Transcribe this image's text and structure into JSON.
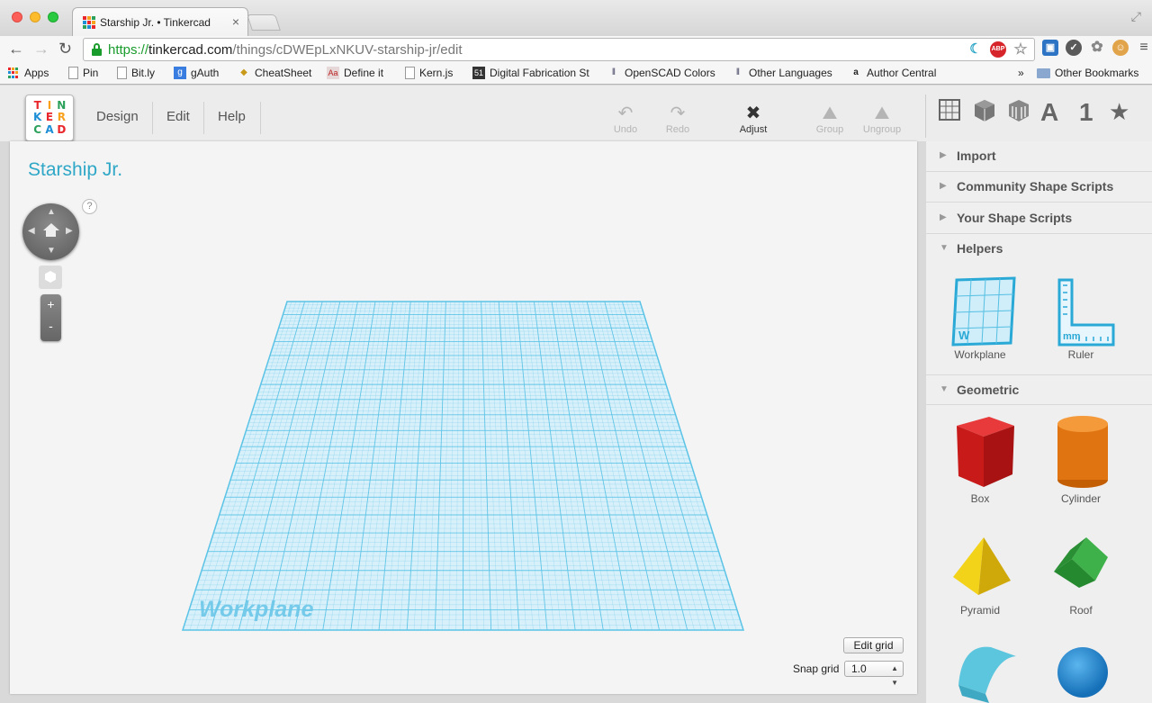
{
  "browser": {
    "tab_title": "Starship Jr. • Tinkercad",
    "url_scheme": "https://",
    "url_host": "tinkercad.com",
    "url_path": "/things/cDWEpLxNKUV-starship-jr/edit",
    "omnibox_ext_abp": "ABP"
  },
  "bookmarks": [
    {
      "label": "Apps"
    },
    {
      "label": "Pin"
    },
    {
      "label": "Bit.ly"
    },
    {
      "label": "gAuth"
    },
    {
      "label": "CheatSheet"
    },
    {
      "label": "Define it"
    },
    {
      "label": "Kern.js"
    },
    {
      "label": "Digital Fabrication St"
    },
    {
      "label": "OpenSCAD Colors"
    },
    {
      "label": "Other Languages"
    },
    {
      "label": "Author Central"
    },
    {
      "label": "Other Bookmarks"
    }
  ],
  "bookmarks_overflow": "»",
  "icons": {
    "g_badge": "g",
    "define_badge": "Aa",
    "calendar_badge": "51",
    "amazon_badge": "a"
  },
  "logo": {
    "letters": [
      "T",
      "I",
      "N",
      "K",
      "E",
      "R",
      "C",
      "A",
      "D"
    ],
    "colors": [
      "#e8262b",
      "#f8a11d",
      "#2ba15b",
      "#1e8fd6",
      "#e8262b",
      "#f8a11d",
      "#2ba15b",
      "#1e8fd6",
      "#e8262b"
    ]
  },
  "menu": {
    "design": "Design",
    "edit": "Edit",
    "help": "Help"
  },
  "tools": {
    "undo": "Undo",
    "redo": "Redo",
    "adjust": "Adjust",
    "group": "Group",
    "ungroup": "Ungroup"
  },
  "categories": {
    "letters": "A",
    "numbers": "1",
    "favorites": "★"
  },
  "canvas": {
    "design_title": "Starship Jr.",
    "help_mark": "?",
    "workplane_label": "Workplane",
    "zoom_in": "+",
    "zoom_out": "-",
    "edit_grid": "Edit grid",
    "snap_grid_label": "Snap grid",
    "snap_grid_value": "1.0"
  },
  "panel": {
    "sections": {
      "import": "Import",
      "community": "Community Shape Scripts",
      "your_scripts": "Your Shape Scripts",
      "helpers": "Helpers",
      "geometric": "Geometric"
    },
    "helpers": {
      "workplane": "Workplane",
      "ruler": "Ruler",
      "workplane_mark": "W",
      "ruler_mark": "mm"
    },
    "geometric": {
      "box": "Box",
      "cylinder": "Cylinder",
      "pyramid": "Pyramid",
      "roof": "Roof"
    }
  },
  "colors": {
    "accent": "#2fa7c7",
    "grid": "#5bc3e6",
    "box": "#d91e1e",
    "cylinder": "#e8770f",
    "pyramid": "#f0cf12",
    "roof": "#2f9e3a",
    "round_roof": "#5cc6de",
    "sphere": "#1f8ad0"
  }
}
